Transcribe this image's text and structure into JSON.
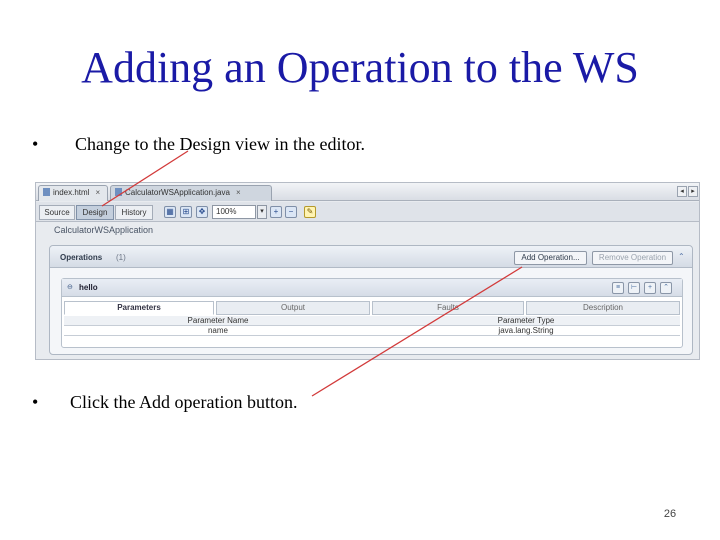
{
  "slide": {
    "title": "Adding an Operation to the WS",
    "bullets": [
      {
        "marker": "•",
        "text": "Change to the Design view in the editor."
      },
      {
        "marker": "•",
        "text": "Click the Add operation button."
      }
    ],
    "page_number": "26"
  },
  "ide": {
    "tabs": [
      {
        "label": "index.html",
        "close": "×"
      },
      {
        "label": "CalculatorWSApplication.java",
        "close": "×"
      }
    ],
    "tab_nav": {
      "left": "◂",
      "right": "▸"
    },
    "view_buttons": {
      "source": "Source",
      "design": "Design",
      "history": "History"
    },
    "zoom": "100%",
    "zoom_arrow": "▾",
    "service_name": "CalculatorWSApplication",
    "operations_panel": {
      "title": "Operations",
      "count": "(1)",
      "add_button": "Add Operation...",
      "remove_button": "Remove Operation",
      "operation": {
        "toggle": "⊖",
        "name": "hello",
        "subtabs": [
          "Parameters",
          "Output",
          "Faults",
          "Description"
        ],
        "param_headers": [
          "Parameter Name",
          "Parameter Type"
        ],
        "params": [
          {
            "name": "name",
            "type": "java.lang.String"
          }
        ]
      }
    }
  },
  "colors": {
    "title": "#1a1aa6",
    "annotation_line": "#d23a3a",
    "selected_view": "#c4cfdd"
  },
  "icons": [
    "file-icon",
    "close-icon",
    "chevron-left-icon",
    "chevron-right-icon",
    "grid-icon",
    "zoom-in-icon",
    "zoom-out-icon",
    "comment-icon",
    "collapse-icon",
    "list-icon",
    "tree-icon"
  ]
}
